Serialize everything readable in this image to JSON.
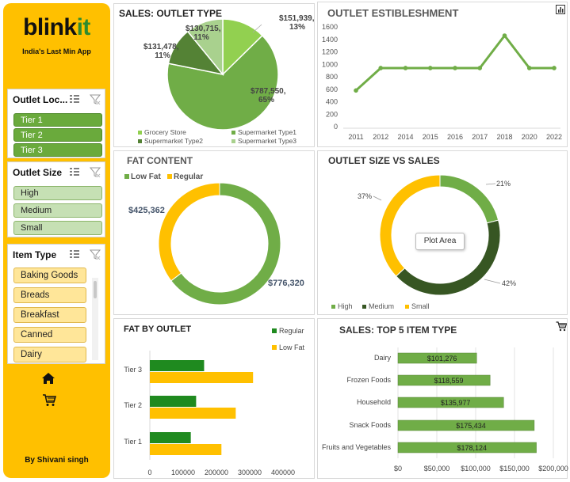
{
  "sidebar": {
    "logo_part1": "blink",
    "logo_part2": "it",
    "tagline": "India's Last Min App",
    "author": "By Shivani singh",
    "slicers": [
      {
        "title": "Outlet Loc...",
        "items": [
          "Tier 1",
          "Tier 2",
          "Tier 3"
        ]
      },
      {
        "title": "Outlet Size",
        "items": [
          "High",
          "Medium",
          "Small"
        ]
      },
      {
        "title": "Item Type",
        "items": [
          "Baking Goods",
          "Breads",
          "Breakfast",
          "Canned",
          "Dairy"
        ]
      }
    ],
    "nav_icons": [
      "home-icon",
      "cart-icon"
    ]
  },
  "colors": {
    "accent": "#ffc000",
    "green_light": "#92d050",
    "green_mid": "#70ad47",
    "green_dark": "#548235",
    "green_darker": "#375623",
    "green_pale": "#a9d18e"
  },
  "chart_data": [
    {
      "id": "outlet_type",
      "type": "pie",
      "title": "SALES: OUTLET TYPE",
      "labels": [
        "Grocery Store",
        "Supermarket Type1",
        "Supermarket Type2",
        "Supermarket Type3"
      ],
      "values": [
        151939,
        787550,
        131478,
        130715
      ],
      "data_labels": [
        "$151,939, 13%",
        "$787,550, 65%",
        "$131,478, 11%",
        "$130,715, 11%"
      ],
      "legend": "bottom"
    },
    {
      "id": "establishment",
      "type": "line",
      "title": "OUTLET ESTIBLESHMENT",
      "x": [
        "2011",
        "2012",
        "2014",
        "2015",
        "2016",
        "2017",
        "2018",
        "2020",
        "2022"
      ],
      "values": [
        580,
        940,
        940,
        940,
        940,
        940,
        1460,
        940,
        940
      ],
      "ylim": [
        0,
        1600
      ],
      "yticks": [
        "0",
        "200",
        "400",
        "600",
        "800",
        "1000",
        "1200",
        "1400",
        "1600"
      ],
      "grid": false
    },
    {
      "id": "fat_content",
      "type": "pie",
      "title": "FAT CONTENT",
      "labels": [
        "Low Fat",
        "Regular"
      ],
      "values": [
        776320,
        425362
      ],
      "data_labels": [
        "$776,320",
        "$425,362"
      ],
      "legend": "top"
    },
    {
      "id": "outlet_size",
      "type": "pie",
      "title": "OUTLET SIZE VS SALES",
      "labels": [
        "High",
        "Medium",
        "Small"
      ],
      "values": [
        21,
        42,
        37
      ],
      "data_labels": [
        "21%",
        "42%",
        "37%"
      ],
      "tooltip": "Plot Area",
      "legend": "bottom"
    },
    {
      "id": "fat_by_outlet",
      "type": "bar",
      "title": "FAT BY OUTLET",
      "categories": [
        "Tier 3",
        "Tier 2",
        "Tier 1"
      ],
      "series": [
        {
          "name": "Regular",
          "values": [
            163000,
            139000,
            123000
          ]
        },
        {
          "name": "Low Fat",
          "values": [
            310000,
            258000,
            215000
          ]
        }
      ],
      "xticks": [
        "0",
        "100000",
        "200000",
        "300000",
        "400000"
      ],
      "xlim": [
        0,
        400000
      ],
      "legend": "top-right"
    },
    {
      "id": "top5_items",
      "type": "bar",
      "title": "SALES: TOP 5 ITEM TYPE",
      "categories": [
        "Dairy",
        "Frozen Foods",
        "Household",
        "Snack Foods",
        "Fruits and Vegetables"
      ],
      "values": [
        101276,
        118559,
        135977,
        175434,
        178124
      ],
      "data_labels": [
        "$101,276",
        "$118,559",
        "$135,977",
        "$175,434",
        "$178,124"
      ],
      "xticks": [
        "$0",
        "$50,000",
        "$100,000",
        "$150,000",
        "$200,000"
      ],
      "xlim": [
        0,
        200000
      ]
    }
  ]
}
